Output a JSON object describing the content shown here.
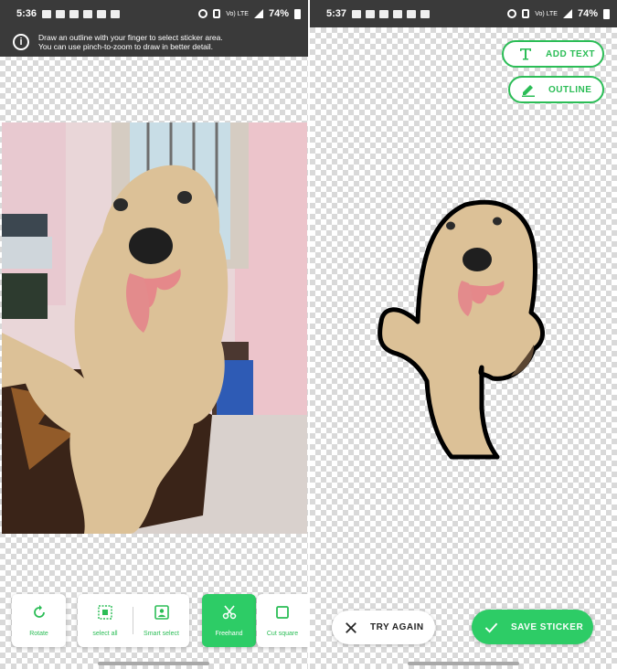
{
  "left_screen": {
    "status": {
      "time": "5:36",
      "battery": "74%",
      "net_label": "Vo) LTE"
    },
    "hint": {
      "line1": "Draw an outline with your finger to select sticker area.",
      "line2": "You can use pinch-to-zoom to draw in better detail."
    },
    "toolbar": {
      "rotate_label": "Rotate",
      "select_all_label": "select all",
      "smart_select_label": "Smart select",
      "freehand_label": "Freehand",
      "cut_square_label": "Cut square"
    }
  },
  "right_screen": {
    "status": {
      "time": "5:37",
      "battery": "74%",
      "net_label": "Vo) LTE"
    },
    "add_text_label": "ADD TEXT",
    "outline_label": "OUTLINE",
    "try_again_label": "TRY AGAIN",
    "save_sticker_label": "SAVE STICKER"
  },
  "colors": {
    "accent_green": "#2dcc66",
    "status_bar": "#3a3a3a"
  }
}
